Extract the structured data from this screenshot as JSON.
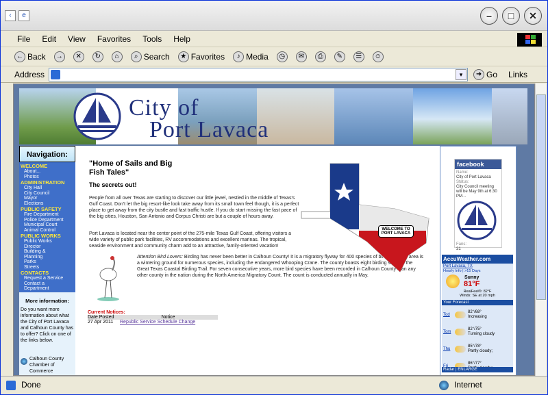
{
  "browser": {
    "menu": [
      "File",
      "Edit",
      "View",
      "Favorites",
      "Tools",
      "Help"
    ],
    "toolbar": {
      "back": "Back",
      "search": "Search",
      "favorites": "Favorites",
      "media": "Media"
    },
    "address": {
      "label": "Address",
      "go": "Go",
      "links": "Links"
    },
    "status": {
      "text": "Done",
      "zone": "Internet"
    }
  },
  "site": {
    "logo": {
      "line1": "City of",
      "line2": "Port Lavaca"
    },
    "nav": {
      "title": "Navigation:",
      "sections": [
        {
          "name": "WELCOME",
          "items": [
            "About...",
            "Photos"
          ]
        },
        {
          "name": "ADMINISTRATION",
          "items": [
            "City Hall",
            "City Council",
            "Mayor",
            "Elections"
          ]
        },
        {
          "name": "PUBLIC SAFETY",
          "items": [
            "Fire Department",
            "Police Department",
            "Municipal Court",
            "Animal Control"
          ]
        },
        {
          "name": "PUBLIC WORKS",
          "items": [
            "Public Works",
            "Director",
            "Building &",
            "Planning",
            "Parks",
            "Streets"
          ]
        },
        {
          "name": "CONTACTS",
          "items": [
            "Request a Service",
            "Contact a",
            "Department"
          ]
        }
      ],
      "more_title": "More information:",
      "more_text": "Do you want more information about what the City of Port Lavaca and Calhoun County has to offer? Click on one of the links below.",
      "chamber": "Calhoun County Chamber of Commerce"
    },
    "main": {
      "heading": "\"Home of Sails and Big Fish Tales\"",
      "sub": "The secrets out!",
      "p1": "People from all over Texas are starting to discover our little jewel, nestled in the middle of Texas's Gulf Coast. Don't let the big resort-like look take away from its small town feel though, it is a perfect place to get away from the city bustle and fast traffic hustle. If you do start missing the fast pace of the big cities, Houston, San Antonio and Corpus Christi are but a couple of hours away.",
      "p2": "Port Lavaca is located near the center point of the 275-mile Texas Gulf Coast, offering visitors a wide variety of public park facilities, RV accommodations and excellent marinas. The tropical, seaside environment and community charm add to an attractive, family-oriented vacation!",
      "p3_em": "Attention Bird Lovers:",
      "p3": " Birding has never been better in Calhoun County! It is a migratory flyway for 400 species of birds, and the area is a wintering ground for numerous species, including the endangered Whooping Crane. The county boasts eight birding sites on the Great Texas Coastal Birding Trail. For seven consecutive years, more bird species have been recorded in Calhoun County than any other county in the nation during the North America Migratory Count. The count is conducted annually in May.",
      "welcome_sign": "WELCOME TO PORT LAVACA",
      "notices_title": "Current Notices:",
      "notices_cols": [
        "Date Posted",
        "Notice"
      ],
      "notices": [
        {
          "date": "27 Apr 2011",
          "notice": "Republic Service Schedule Change"
        }
      ]
    },
    "facebook": {
      "brand": "facebook",
      "name_label": "Name:",
      "name": "City of Port Lavaca",
      "status_label": "Status:",
      "status": "City Council meeting will be May 9th at 6:30 PM...",
      "fans_label": "Fans:",
      "fans": "31"
    },
    "weather": {
      "brand": "AccuWeather.com",
      "city": "Port Lavaca, TX",
      "links": "Hourly Info | >15 Days",
      "cond": "Sunny",
      "temp": "81°F",
      "realfeel": "RealFeel®: 82°F",
      "winds": "Winds: SE at 20 mph",
      "forecast_title": "Your Forecast",
      "forecast": [
        {
          "day": "Tod",
          "temps": "82°/68°",
          "desc": "Increasing"
        },
        {
          "day": "Tom",
          "temps": "82°/75°",
          "desc": "Turning cloudy"
        },
        {
          "day": "Thu",
          "temps": "85°/78°",
          "desc": "Partly cloudy;"
        },
        {
          "day": "Fri",
          "temps": "86°/77°",
          "desc": "Partly cloudy;"
        }
      ],
      "radar": "Radar | ENLARGE"
    }
  }
}
